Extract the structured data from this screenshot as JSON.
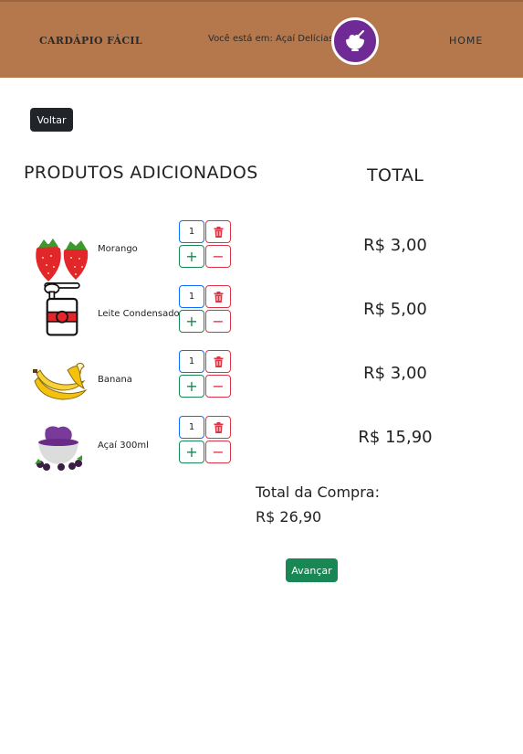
{
  "header": {
    "brand": "CARDÁPIO FÁCIL",
    "location_text": "Você está em: Açaí Delícias",
    "logo_icon": "acai-bowl-icon",
    "nav_home": "HOME",
    "bg_color": "#b5784c",
    "logo_color": "#6f2a96"
  },
  "actions": {
    "back_label": "Voltar",
    "next_label": "Avançar"
  },
  "cart": {
    "products_heading": "PRODUTOS ADICIONADOS",
    "total_heading": "TOTAL",
    "items": [
      {
        "name": "Morango",
        "quantity": "1",
        "price": "R$ 3,00",
        "icon": "strawberry-icon"
      },
      {
        "name": "Leite Condensado",
        "quantity": "1",
        "price": "R$ 5,00",
        "icon": "condensed-milk-can-icon"
      },
      {
        "name": "Banana",
        "quantity": "1",
        "price": "R$ 3,00",
        "icon": "banana-icon"
      },
      {
        "name": "Açaí 300ml",
        "quantity": "1",
        "price": "R$ 15,90",
        "icon": "acai-bowl-icon"
      }
    ],
    "total_label": "Total da Compra:",
    "total_value": "R$ 26,90"
  },
  "colors": {
    "accent_success": "#198754",
    "accent_danger": "#dc3545",
    "accent_primary": "#0d6efd",
    "dark_button": "#212529"
  }
}
